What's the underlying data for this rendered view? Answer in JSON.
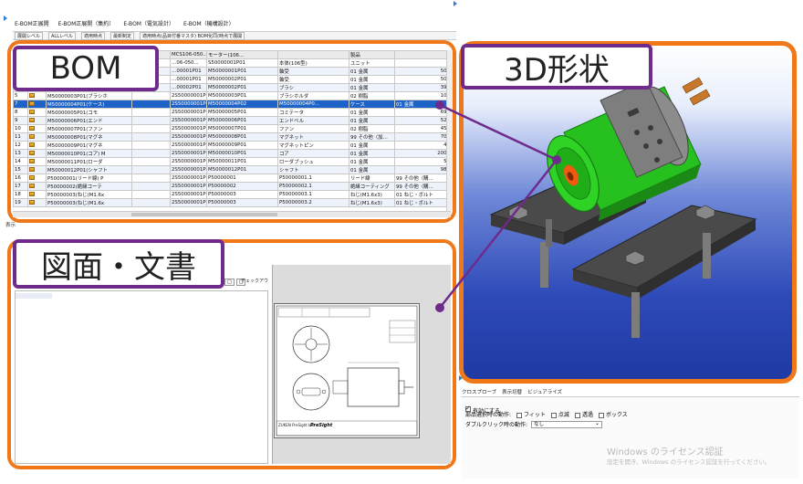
{
  "tabs": [
    "E-BOM正展開",
    "E-BOM正展開（集約）",
    "E-BOM（電気設計）",
    "E-BOM（機構設計）"
  ],
  "toolbar": [
    "展開レベル",
    "ALLレベル",
    "適用時点",
    "最新制定",
    "適用時点(品目付番マスタ) BOM化同(時点で展開"
  ],
  "callouts": {
    "bom": "BOM",
    "shape3d": "3D形状",
    "docs": "図面・文書"
  },
  "grid": {
    "header_row": [
      "",
      "",
      "MCS106-050...",
      "モーター(106...",
      "",
      "製品",
      ""
    ],
    "rows": [
      {
        "no": "",
        "item": "",
        "c1": "…06-050...",
        "c2": "S50000001P01",
        "c3": "本体(106型)",
        "c4": "ユニット",
        "qty": ""
      },
      {
        "no": "",
        "item": "",
        "c1": "…00001P01",
        "c2": "M50000001P01",
        "c3": "軸受",
        "c4": "01 金属",
        "qty": "500"
      },
      {
        "no": "",
        "item": "",
        "c1": "…00001P01",
        "c2": "M50000002P01",
        "c3": "軸受",
        "c4": "01 金属",
        "qty": "500"
      },
      {
        "no": "",
        "item": "",
        "c1": "…00002P01",
        "c2": "M50000002P01",
        "c3": "ブラシ",
        "c4": "01 金属",
        "qty": "398"
      },
      {
        "no": "5",
        "item": "M50000003P01(ブラシホ",
        "c1": "2S50000001P01",
        "c2": "M50000003P01",
        "c3": "ブラシホルダ",
        "c4": "02 樹脂",
        "qty": "100"
      },
      {
        "no": "7",
        "item": "M50000004P01(ケース)",
        "c1": "2S50000001P01",
        "c2": "M50000004P02",
        "c3": "M50000004P0...",
        "c4": "ケース",
        "c5": "01 金属",
        "qty": "1200",
        "selected": true
      },
      {
        "no": "8",
        "item": "M50000005P01(コモ",
        "c1": "2S50000001P01",
        "c2": "M50000005P01",
        "c3": "コミテータ",
        "c4": "01 金属",
        "qty": "690"
      },
      {
        "no": "9",
        "item": "M50000006P01(エンド",
        "c1": "2S50000001P01",
        "c2": "M50000006P01",
        "c3": "エンドベル",
        "c4": "01 金属",
        "qty": "525"
      },
      {
        "no": "10",
        "item": "M50000007P01(ファン",
        "c1": "2S50000001P01",
        "c2": "M50000007P01",
        "c3": "ファン",
        "c4": "02 樹脂",
        "qty": "450"
      },
      {
        "no": "11",
        "item": "M50000008P01(マグネ",
        "c1": "2S50000001P01",
        "c2": "M50000008P01",
        "c3": "マグネット",
        "c4": "99 その他（加…",
        "qty": "700"
      },
      {
        "no": "12",
        "item": "M50000009P01(マグネ",
        "c1": "2S50000001P01",
        "c2": "M50000009P01",
        "c3": "マグネットピン",
        "c4": "01 金属",
        "qty": "40"
      },
      {
        "no": "13",
        "item": "M50000010P01(コア) M",
        "c1": "2S50000001P01",
        "c2": "M50000010P01",
        "c3": "コア",
        "c4": "01 金属",
        "qty": "2000"
      },
      {
        "no": "14",
        "item": "M50000011P01(ローダ",
        "c1": "2S50000001P01",
        "c2": "M50000011P01",
        "c3": "ローダブッシュ",
        "c4": "01 金属",
        "qty": "50"
      },
      {
        "no": "15",
        "item": "M50000012P01(シャフト",
        "c1": "2S50000001P01",
        "c2": "M50000012P01",
        "c3": "シャフト",
        "c4": "01 金属",
        "qty": "980"
      },
      {
        "no": "16",
        "item": "P50000001(リード線) P",
        "c1": "2S50000001P01",
        "c2": "P50000001",
        "c3": "P50000001.1",
        "c4": "リード線",
        "c5": "99 その他（購…",
        "qty": "100"
      },
      {
        "no": "17",
        "item": "P50000002(絶縁コーテ",
        "c1": "2S50000001P01",
        "c2": "P50000002",
        "c3": "P50000002.1",
        "c4": "絶縁コーティング",
        "c5": "99 その他（購…",
        "qty": "200"
      },
      {
        "no": "18",
        "item": "P50000003(ねじ(M1.6x",
        "c1": "2S50000001P01",
        "c2": "P50000003",
        "c3": "P50000003.1",
        "c4": "ねじ(M1.6x3)",
        "c5": "01 ねじ・ボルト",
        "qty": "7"
      },
      {
        "no": "19",
        "item": "P50000003(ねじ(M1.6x",
        "c1": "2S50000001P01",
        "c2": "P50000003",
        "c3": "P50000003.2",
        "c4": "ねじ(M1.6x3)",
        "c5": "01 ねじ・ボルト",
        "qty": "7"
      }
    ]
  },
  "section_label": "表示",
  "doc_pane": {
    "toolbar_buttons": [
      "□",
      "□"
    ],
    "check_label": "チェックアウ",
    "title_block_name": "ZUKEN PreSight Inc.",
    "title_block_logo": "PreSight"
  },
  "props": {
    "tabs": [
      "クロスプローブ",
      "表示切替",
      "ビジュアライズ"
    ],
    "valid_label": "有効にする",
    "valid_checked": true,
    "select_action_label": "部品選択時の動作:",
    "options": [
      {
        "label": "フィット",
        "checked": false
      },
      {
        "label": "点滅",
        "checked": false
      },
      {
        "label": "透過",
        "checked": false
      },
      {
        "label": "ボックス",
        "checked": false
      }
    ],
    "dblclick_label": "ダブルクリック時の動作:",
    "dblclick_value": "なし"
  },
  "watermark": {
    "line1": "Windows のライセンス認証",
    "line2": "設定を開き、Windows のライセンス認証を行ってください。"
  },
  "colors": {
    "frame": "#f07818",
    "callout_border": "#6e2b8c",
    "selection": "#1e64c8",
    "motor_green": "#26c11f",
    "viewer_blue": "#2e4ab8"
  }
}
